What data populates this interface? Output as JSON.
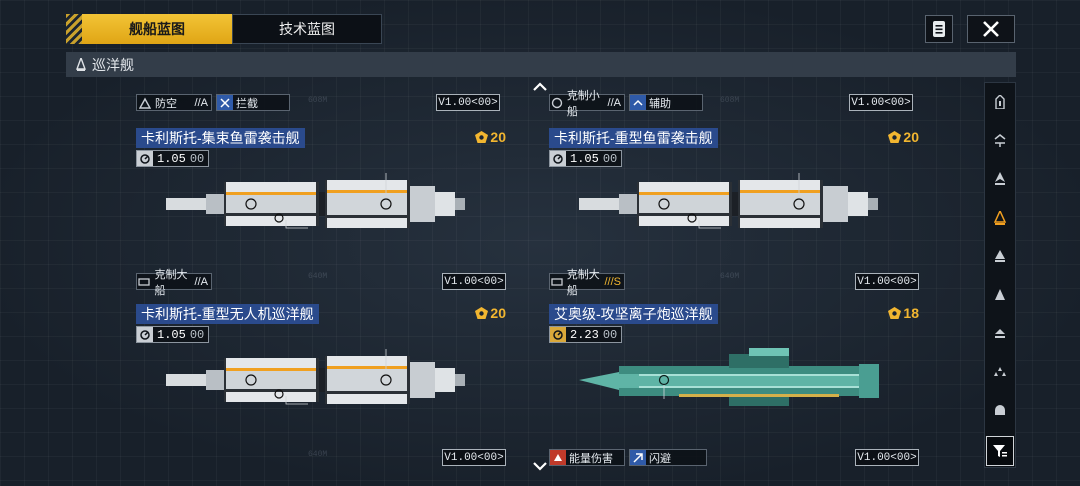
{
  "tabs": [
    {
      "label": "舰船蓝图",
      "active": true
    },
    {
      "label": "技术蓝图",
      "active": false
    }
  ],
  "header": {
    "notes_icon": "notes-icon",
    "close_icon": "close-icon"
  },
  "category": {
    "label": "巡洋舰",
    "icon": "cruiser-icon"
  },
  "colors": {
    "accent": "#f2c436",
    "name_bg": "#2a4a8c",
    "cost": "#f2b630"
  },
  "top_partial_cards": [
    {
      "role": "防空",
      "grade": "//A",
      "subrole": "拦截",
      "version": "V1.00<00>"
    },
    {
      "role": "克制小船",
      "grade": "//A",
      "subrole": "辅助",
      "version": "V1.00<00>"
    }
  ],
  "cards": [
    {
      "name": "卡利斯托-集束鱼雷袭击舰",
      "cost": "20",
      "stat": "1.05",
      "stat_suffix": "00",
      "role": "克制大船",
      "grade": "//A",
      "version": "V1.00<00>",
      "ship_style": "white"
    },
    {
      "name": "卡利斯托-重型鱼雷袭击舰",
      "cost": "20",
      "stat": "1.05",
      "stat_suffix": "00",
      "role": "克制大船",
      "grade": "///S",
      "version": "V1.00<00>",
      "ship_style": "white"
    },
    {
      "name": "卡利斯托-重型无人机巡洋舰",
      "cost": "20",
      "stat": "1.05",
      "stat_suffix": "00",
      "role": "",
      "grade": "",
      "version": "V1.00<00>",
      "ship_style": "white"
    },
    {
      "name": "艾奥级-攻坚离子炮巡洋舰",
      "cost": "18",
      "stat": "2.23",
      "stat_suffix": "00",
      "role": "能量伤害",
      "grade": "",
      "subrole": "闪避",
      "version": "V1.00<00>",
      "ship_style": "teal"
    }
  ],
  "sidebar": [
    {
      "icon": "frigate-icon",
      "active": false
    },
    {
      "icon": "destroyer-icon",
      "active": false
    },
    {
      "icon": "corvette-icon",
      "active": false
    },
    {
      "icon": "cruiser-icon",
      "active": true
    },
    {
      "icon": "battlecruiser-icon",
      "active": false
    },
    {
      "icon": "carrier-icon",
      "active": false
    },
    {
      "icon": "auxiliary-icon",
      "active": false
    },
    {
      "icon": "fleet-icon",
      "active": false
    },
    {
      "icon": "station-icon",
      "active": false
    }
  ],
  "filter_icon": "filter-icon",
  "scroll": {
    "up_icon": "chevron-up-icon",
    "down_icon": "chevron-down-icon"
  }
}
